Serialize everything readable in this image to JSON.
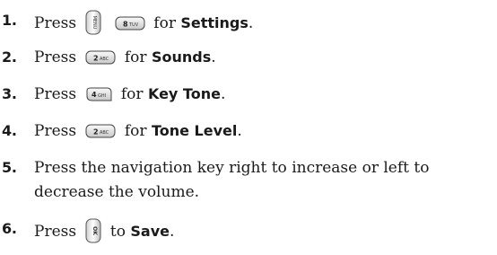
{
  "steps": [
    {
      "number": "1.",
      "pre": "Press",
      "key1_label": "MENU",
      "key2_label": "8 TUV",
      "mid": "for",
      "target": "Settings",
      "post": "."
    },
    {
      "number": "2.",
      "pre": "Press",
      "key_label": "2 ABC",
      "mid": "for",
      "target": "Sounds",
      "post": "."
    },
    {
      "number": "3.",
      "pre": "Press",
      "key_label": "4 GHI",
      "mid": "for",
      "target": "Key Tone",
      "post": "."
    },
    {
      "number": "4.",
      "pre": "Press",
      "key_label": "2 ABC",
      "mid": "for",
      "target": "Tone Level",
      "post": "."
    },
    {
      "number": "5.",
      "line1": "Press the navigation key right to increase or left to",
      "line2": "decrease the volume."
    },
    {
      "number": "6.",
      "pre": "Press",
      "key_label": "OK",
      "mid": "to",
      "target": "Save",
      "post": "."
    }
  ]
}
